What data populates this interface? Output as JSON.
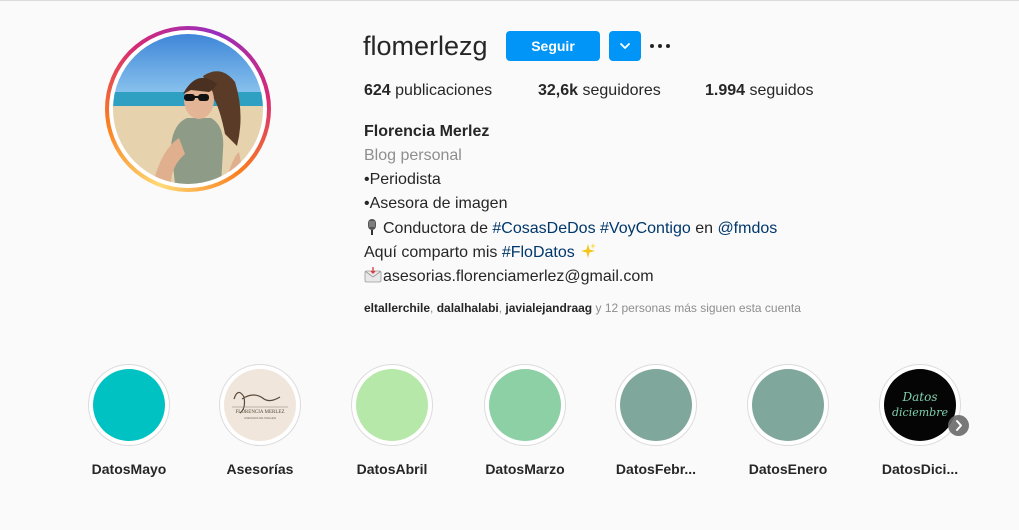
{
  "profile": {
    "username": "flomerlezg",
    "follow_label": "Seguir",
    "stats": [
      {
        "count": "624",
        "label": "publicaciones"
      },
      {
        "count": "32,6k",
        "label": "seguidores"
      },
      {
        "count": "1.994",
        "label": "seguidos"
      }
    ],
    "full_name": "Florencia Merlez",
    "category": "Blog personal",
    "bio": {
      "line1": "•Periodista",
      "line2": "•Asesora de imagen",
      "line3_prefix": "Conductora de ",
      "line3_tag1": "#CosasDeDos",
      "line3_tag2": "#VoyContigo",
      "line3_mid": " en ",
      "line3_mention": "@fmdos",
      "line4_prefix": "Aquí comparto mis ",
      "line4_tag": "#FloDatos",
      "line5": "asesorias.florenciamerlez@gmail.com"
    },
    "followed_by": {
      "user1": "eltallerchile",
      "user2": "dalalhalabi",
      "user3": "javialejandraag",
      "suffix": "y 12 personas más siguen esta cuenta"
    }
  },
  "highlights": [
    {
      "label": "DatosMayo",
      "color": "#00c2c2"
    },
    {
      "label": "Asesorías",
      "color": "#f0e6dc",
      "logo_text": "FLORENCIA MERLEZ",
      "logo_sub": "ASESORA DE IMAGEN"
    },
    {
      "label": "DatosAbril",
      "color": "#b6e8a9"
    },
    {
      "label": "DatosMarzo",
      "color": "#8ed0a6"
    },
    {
      "label": "DatosFebr...",
      "color": "#7fa79c"
    },
    {
      "label": "DatosEnero",
      "color": "#7fa79c"
    },
    {
      "label": "DatosDici...",
      "color": "#050505",
      "cover_text_1": "Datos",
      "cover_text_2": "diciembre"
    }
  ],
  "icons": {
    "dropdown": "chevron-down-icon",
    "more": "more-horizontal-icon",
    "mic": "microphone-emoji",
    "sparkles": "sparkles-emoji",
    "mail": "envelope-emoji",
    "next": "chevron-right-icon"
  }
}
